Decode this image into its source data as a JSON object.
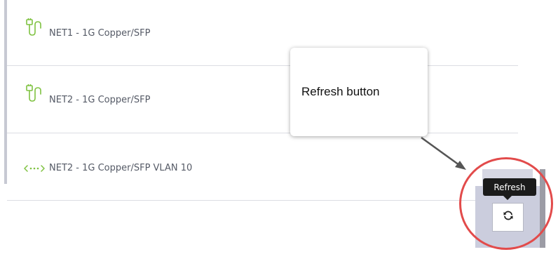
{
  "interfaces": [
    {
      "label": "NET1 - 1G Copper/SFP",
      "icon": "ethernet-cable-icon"
    },
    {
      "label": "NET2 - 1G Copper/SFP",
      "icon": "ethernet-cable-icon"
    },
    {
      "label": "NET2 - 1G Copper/SFP VLAN 10",
      "icon": "vlan-icon"
    }
  ],
  "callout": {
    "text": "Refresh button"
  },
  "toolbar": {
    "refresh_tooltip": "Refresh",
    "refresh_icon": "refresh-icon"
  },
  "colors": {
    "icon_green": "#7fc241",
    "highlight_red": "#e24b4b",
    "text": "#555a66"
  }
}
